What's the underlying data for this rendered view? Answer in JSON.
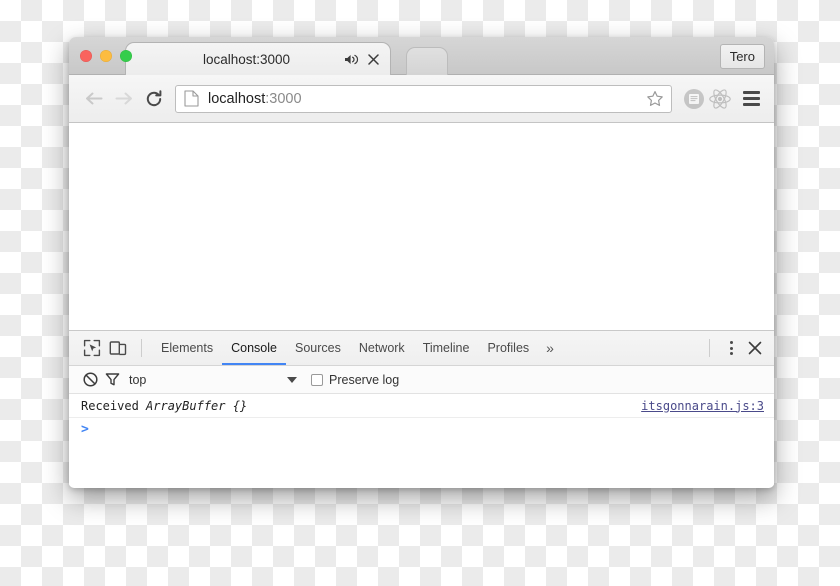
{
  "window": {
    "traffic_lights": [
      {
        "name": "close",
        "color": "#f9635e"
      },
      {
        "name": "minimize",
        "color": "#fcbc40"
      },
      {
        "name": "zoom",
        "color": "#35cd4b"
      }
    ]
  },
  "tabstrip": {
    "tab_title": "localhost:3000",
    "audio_icon": "speaker-icon",
    "close_icon": "close-icon",
    "new_tab_icon": "new-tab-icon",
    "profile_label": "Tero"
  },
  "navbar": {
    "back_icon": "back-arrow-icon",
    "forward_icon": "forward-arrow-icon",
    "reload_icon": "reload-icon",
    "page_icon": "page-document-icon",
    "url_host": "localhost",
    "url_port": ":3000",
    "url_full": "localhost:3000",
    "star_icon": "star-bookmark-icon",
    "extensions": [
      {
        "name": "reading-list-extension-icon"
      },
      {
        "name": "react-devtools-extension-icon"
      }
    ],
    "menu_icon": "hamburger-menu-icon"
  },
  "devtools": {
    "inspect_icon": "inspect-element-icon",
    "device_icon": "device-toolbar-icon",
    "tabs": [
      {
        "label": "Elements",
        "active": false
      },
      {
        "label": "Console",
        "active": true
      },
      {
        "label": "Sources",
        "active": false
      },
      {
        "label": "Network",
        "active": false
      },
      {
        "label": "Timeline",
        "active": false
      },
      {
        "label": "Profiles",
        "active": false
      }
    ],
    "overflow_label": "»",
    "kebab_icon": "more-options-icon",
    "close_icon": "close-devtools-icon",
    "accent_color": "#4285f4",
    "filterbar": {
      "clear_icon": "clear-console-icon",
      "filter_icon": "filter-funnel-icon",
      "context_label": "top",
      "caret_icon": "chevron-down-icon",
      "preserve_log_label": "Preserve log",
      "preserve_log_checked": false
    },
    "console": {
      "messages": [
        {
          "text": "Received",
          "object": "ArrayBuffer {}",
          "source": "itsgonnarain.js:3"
        }
      ],
      "prompt": ">"
    }
  }
}
